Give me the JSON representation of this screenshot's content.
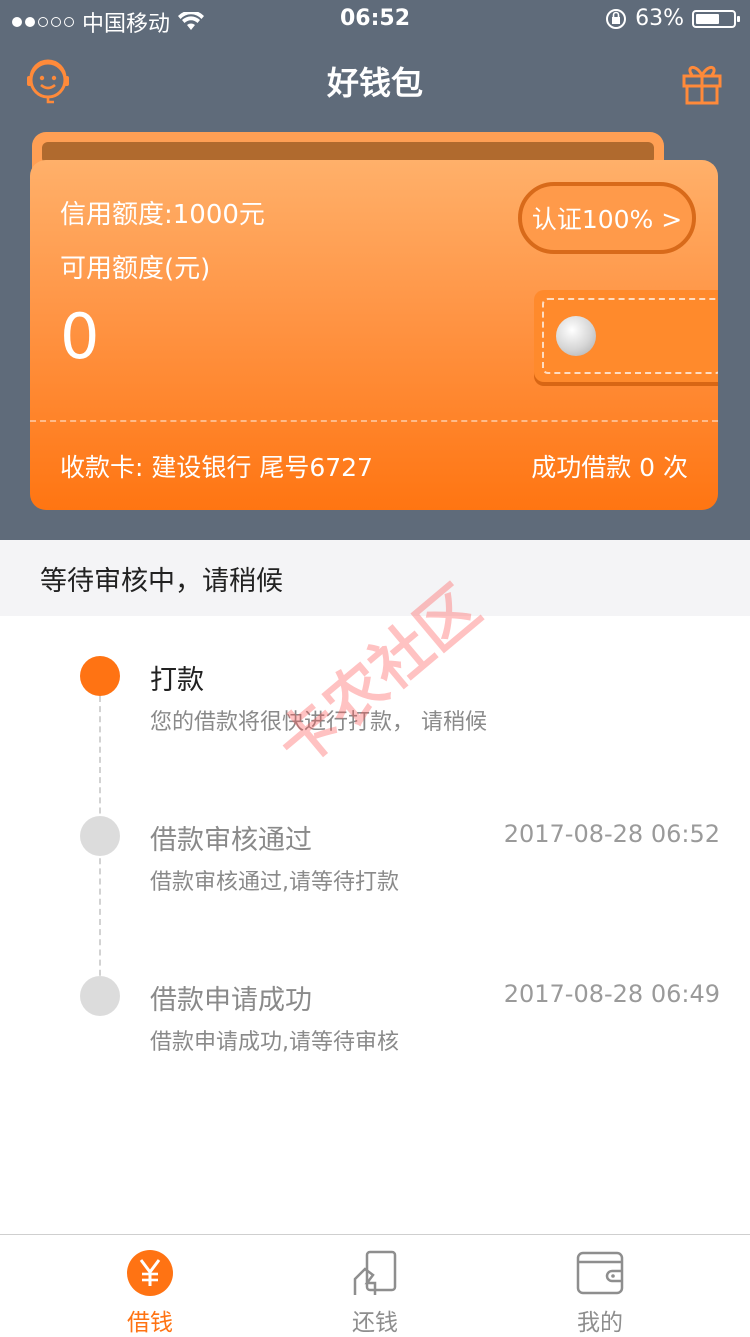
{
  "status_bar": {
    "carrier": "中国移动",
    "time": "06:52",
    "battery": "63%",
    "battery_level": 0.63
  },
  "navbar": {
    "title": "好钱包",
    "left_icon": "customer-service-icon",
    "right_icon": "gift-icon"
  },
  "card": {
    "credit_limit": "信用额度:1000元",
    "available_label": "可用额度(元)",
    "available_value": "0",
    "cert_label": "认证100% >",
    "bank_info": "收款卡:  建设银行 尾号6727",
    "loan_count": "成功借款 0 次",
    "colors": {
      "card_top": "#ffb06a",
      "card_bottom": "#ff7512",
      "top_bg": "#5f6b7a"
    }
  },
  "banner": {
    "text": "等待审核中，请稍候"
  },
  "timeline": [
    {
      "title": "打款",
      "desc": "您的借款将很快进行打款， 请稍候",
      "time": "",
      "active": true
    },
    {
      "title": "借款审核通过",
      "desc": "借款审核通过,请等待打款",
      "time": "2017-08-28 06:52",
      "active": false
    },
    {
      "title": "借款申请成功",
      "desc": "借款申请成功,请等待审核",
      "time": "2017-08-28 06:49",
      "active": false
    }
  ],
  "watermark": "卡农社区",
  "tabs": [
    {
      "label": "借钱",
      "icon": "yen-circle-icon",
      "active": true
    },
    {
      "label": "还钱",
      "icon": "repay-icon",
      "active": false
    },
    {
      "label": "我的",
      "icon": "wallet-icon",
      "active": false
    }
  ],
  "accent_color": "#ff7313"
}
